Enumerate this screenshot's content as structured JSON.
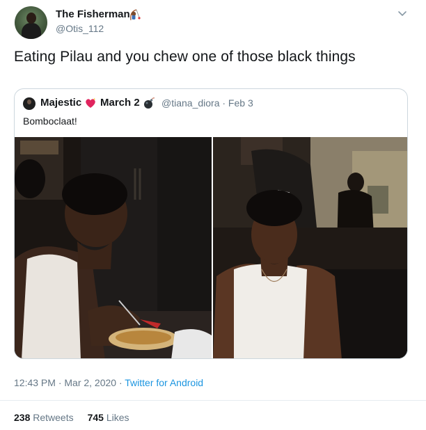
{
  "author": {
    "name": "The Fisherman",
    "name_emoji_icon": "fisherman-emoji",
    "handle": "@Otis_112"
  },
  "menu_icon": "chevron-down-icon",
  "tweet": {
    "text": "Eating Pilau and you chew one of those black things"
  },
  "quoted_tweet": {
    "name_part1": "Majestic",
    "heart_icon": "sparkling-heart-emoji",
    "name_part2": "March 2",
    "bomb_icon": "bomb-emoji",
    "handle_date": "@tiana_diora · Feb 3",
    "text": "Bomboclaat!",
    "images": [
      "photo-left",
      "photo-right"
    ]
  },
  "meta": {
    "time_date": "12:43 PM · Mar 2, 2020 · ",
    "source": "Twitter for Android"
  },
  "stats": {
    "retweets_count": "238",
    "retweets_label": "Retweets",
    "likes_count": "745",
    "likes_label": "Likes"
  },
  "colors": {
    "link": "#1b95e0",
    "secondary_text": "#657786",
    "border": "#ccd6dd"
  }
}
